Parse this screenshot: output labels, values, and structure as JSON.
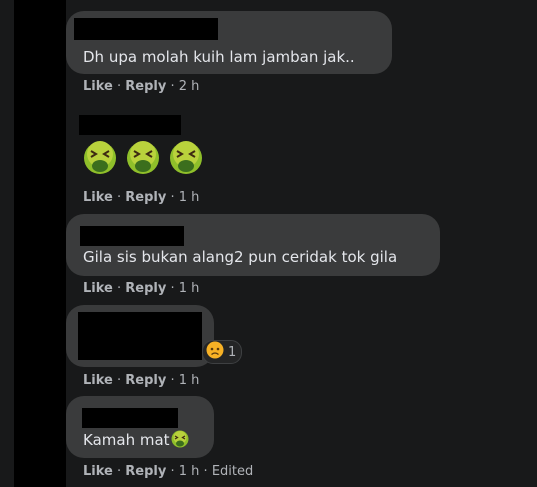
{
  "comments": [
    {
      "text": "Dh upa molah kuih lam jamban jak..",
      "like": "Like",
      "reply": "Reply",
      "time": "2 h"
    },
    {
      "emoji_icons": [
        "nauseated-face-icon",
        "nauseated-face-icon",
        "nauseated-face-icon"
      ],
      "like": "Like",
      "reply": "Reply",
      "time": "1 h"
    },
    {
      "text": "Gila sis bukan alang2 pun ceridak tok gila",
      "like": "Like",
      "reply": "Reply",
      "time": "1 h"
    },
    {
      "reaction_icon": "sad-face-icon",
      "reaction_count": "1",
      "like": "Like",
      "reply": "Reply",
      "time": "1 h"
    },
    {
      "text": "Kamah mat",
      "text_emoji_icon": "nauseated-face-icon",
      "like": "Like",
      "reply": "Reply",
      "time": "1 h",
      "edited": "Edited"
    }
  ],
  "colors": {
    "bubble": "#3a3b3c",
    "background": "#18191a",
    "text": "#e4e6eb",
    "meta": "#b0b3b8",
    "redaction": "#000000"
  }
}
